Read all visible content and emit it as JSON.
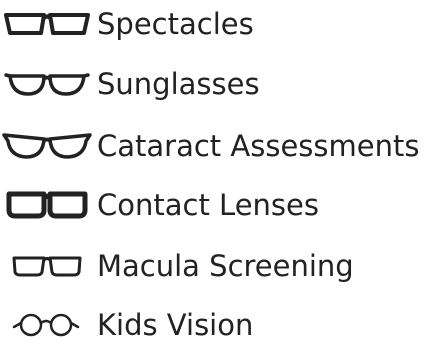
{
  "services": [
    {
      "label": "Spectacles",
      "icon": "rectangular-glasses-icon"
    },
    {
      "label": "Sunglasses",
      "icon": "rounded-glasses-icon"
    },
    {
      "label": "Cataract Assessments",
      "icon": "cat-eye-glasses-icon"
    },
    {
      "label": "Contact Lenses",
      "icon": "bold-rectangular-glasses-icon"
    },
    {
      "label": "Macula Screening",
      "icon": "wide-rectangular-glasses-icon"
    },
    {
      "label": "Kids Vision",
      "icon": "round-glasses-icon"
    }
  ],
  "colors": {
    "text": "#222222",
    "icon_stroke": "#222222",
    "background": "#ffffff"
  }
}
